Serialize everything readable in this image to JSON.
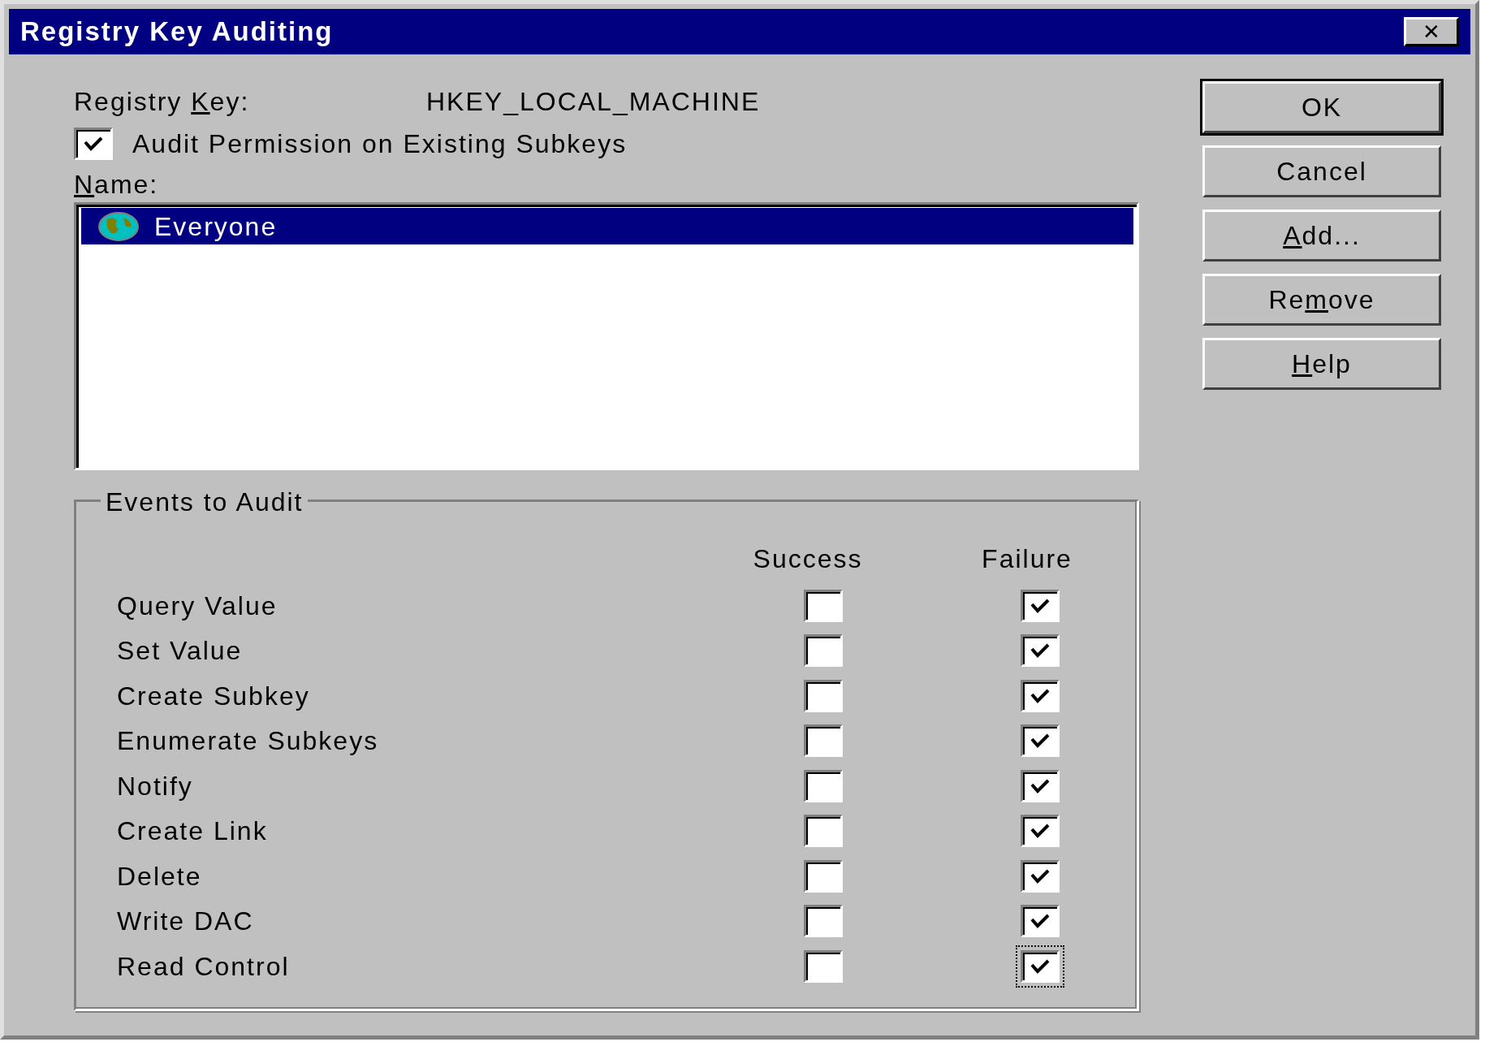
{
  "window": {
    "title": "Registry Key Auditing",
    "close_glyph": "✕"
  },
  "registry_key": {
    "label": {
      "pre": "Registry ",
      "key": "K",
      "post": "ey:"
    },
    "value": "HKEY_LOCAL_MACHINE"
  },
  "audit_existing_subkeys": {
    "label": "Audit Permission on Existing Subkeys",
    "checked": true
  },
  "name_label": {
    "key": "N",
    "post": "ame:"
  },
  "names": [
    {
      "label": "Everyone",
      "selected": true
    }
  ],
  "events": {
    "legend": "Events to Audit",
    "columns": [
      "Success",
      "Failure"
    ],
    "rows": [
      {
        "label": "Query Value",
        "success": false,
        "failure": true,
        "failure_focused": false
      },
      {
        "label": "Set Value",
        "success": false,
        "failure": true,
        "failure_focused": false
      },
      {
        "label": "Create Subkey",
        "success": false,
        "failure": true,
        "failure_focused": false
      },
      {
        "label": "Enumerate Subkeys",
        "success": false,
        "failure": true,
        "failure_focused": false
      },
      {
        "label": "Notify",
        "success": false,
        "failure": true,
        "failure_focused": false
      },
      {
        "label": "Create Link",
        "success": false,
        "failure": true,
        "failure_focused": false
      },
      {
        "label": "Delete",
        "success": false,
        "failure": true,
        "failure_focused": false
      },
      {
        "label": "Write DAC",
        "success": false,
        "failure": true,
        "failure_focused": false
      },
      {
        "label": "Read Control",
        "success": false,
        "failure": true,
        "failure_focused": true
      }
    ]
  },
  "buttons": [
    {
      "post": "OK",
      "default": true
    },
    {
      "post": "Cancel",
      "default": false
    },
    {
      "key": "A",
      "post": "dd...",
      "default": false
    },
    {
      "pre": "Re",
      "key": "m",
      "post": "ove",
      "default": false
    },
    {
      "key": "H",
      "post": "elp",
      "default": false
    }
  ]
}
